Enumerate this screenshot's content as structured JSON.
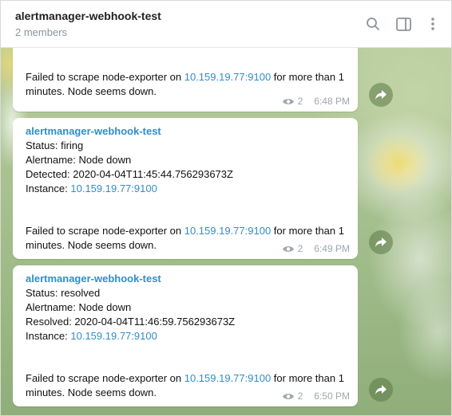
{
  "header": {
    "title": "alertmanager-webhook-test",
    "subtitle": "2 members",
    "icons": [
      "search-icon",
      "sidebar-toggle-icon",
      "more-vertical-icon"
    ]
  },
  "messages": [
    {
      "failed_pre": "Failed to scrape node-exporter on ",
      "failed_link": "10.159.19.77:9100",
      "failed_post": " for more than 1 minutes. Node seems down.",
      "views": "2",
      "time": "6:48 PM"
    },
    {
      "sender": "alertmanager-webhook-test",
      "status": "Status: firing",
      "alertname": "Alertname: Node down",
      "datetime": "Detected: 2020-04-04T11:45:44.756293673Z",
      "instance_label": "Instance: ",
      "instance_link": "10.159.19.77:9100",
      "failed_pre": "Failed to scrape node-exporter on ",
      "failed_link": "10.159.19.77:9100",
      "failed_post": " for more than 1 minutes. Node seems down.",
      "views": "2",
      "time": "6:49 PM"
    },
    {
      "sender": "alertmanager-webhook-test",
      "status": "Status: resolved",
      "alertname": "Alertname: Node down",
      "datetime": "Resolved: 2020-04-04T11:46:59.756293673Z",
      "instance_label": "Instance: ",
      "instance_link": "10.159.19.77:9100",
      "failed_pre": "Failed to scrape node-exporter on ",
      "failed_link": "10.159.19.77:9100",
      "failed_post": " for more than 1 minutes. Node seems down.",
      "views": "2",
      "time": "6:50 PM"
    }
  ],
  "colors": {
    "link": "#2f8fc7",
    "meta": "#a0a7ad",
    "forward_button": "#6f8d5c"
  }
}
